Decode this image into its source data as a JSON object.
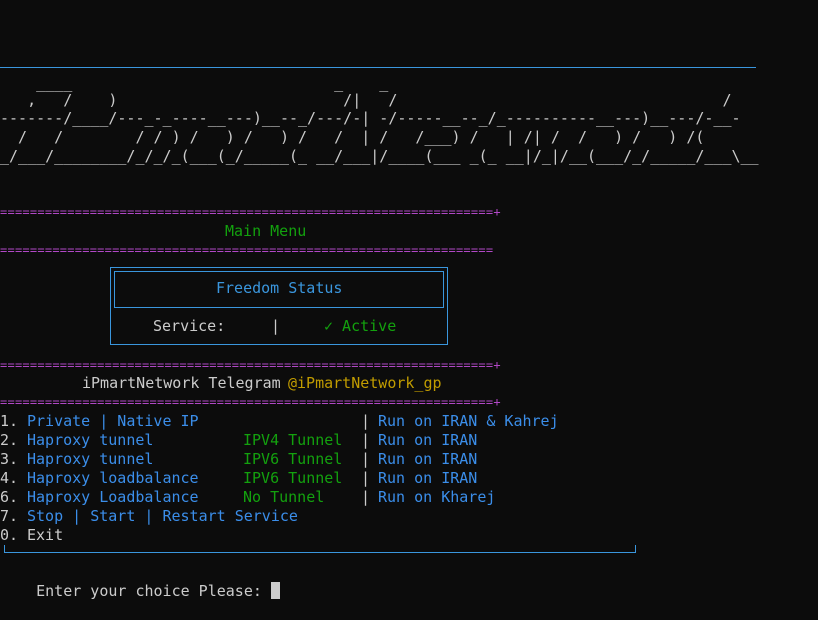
{
  "banner": {
    "art_lines": [
      "    ____                             _    _",
      "   ,   /    )                         /|   /                                    /",
      "-------/____/---_-_----__---)__--_/---/-| -/-----__--_/_----------__---)__---/-__-",
      "  /   /        / / ) /   ) /   ) /   /  | /   /___) /   | /| /  /   ) /   ) /(",
      "_/___/________/_/_/_(___(_/_____(_ __/___|/____(___ _(_ __|/_|/__(___/_/_____/___\\__"
    ]
  },
  "rules": {
    "double": "==================================================================+",
    "double_plain": "=================================================================="
  },
  "menu": {
    "title": "Main Menu",
    "status_box": {
      "title": "Freedom Status",
      "service_label": "Service:",
      "separator": "|",
      "service_value": "✓ Active"
    },
    "telegram_label": "iPmartNetwork Telegram",
    "telegram_handle": "@iPmartNetwork_gp",
    "items": [
      {
        "num": "1.",
        "label": "Private | Native IP",
        "tunnel": "",
        "sep": "|",
        "run": "Run on IRAN & Kahrej",
        "label_color": "white"
      },
      {
        "num": "2.",
        "label": "Haproxy tunnel",
        "tunnel": "IPV4 Tunnel",
        "sep": "|",
        "run": "Run on IRAN",
        "label_color": "blue"
      },
      {
        "num": "3.",
        "label": "Haproxy tunnel",
        "tunnel": "IPV6 Tunnel",
        "sep": "|",
        "run": "Run on IRAN",
        "label_color": "white"
      },
      {
        "num": "4.",
        "label": "Haproxy loadbalance",
        "tunnel": "IPV6 Tunnel",
        "sep": "|",
        "run": "Run on IRAN",
        "label_color": "blue"
      },
      {
        "num": "6.",
        "label": "Haproxy Loadbalance",
        "tunnel": "No Tunnel",
        "sep": "|",
        "run": "Run on Kharej",
        "label_color": "white"
      }
    ],
    "service_item": {
      "num": "7.",
      "label": "Stop | Start | Restart Service"
    },
    "exit_item": {
      "num": "0.",
      "label": "Exit"
    }
  },
  "prompt": {
    "text": "Enter your choice Please: "
  },
  "colors": {
    "background": "#0c0c0c",
    "magenta_rule": "#b148c6",
    "cyan": "#3a96dd",
    "green": "#13a10e",
    "blue": "#3b8eea",
    "yellow": "#c19c00"
  }
}
